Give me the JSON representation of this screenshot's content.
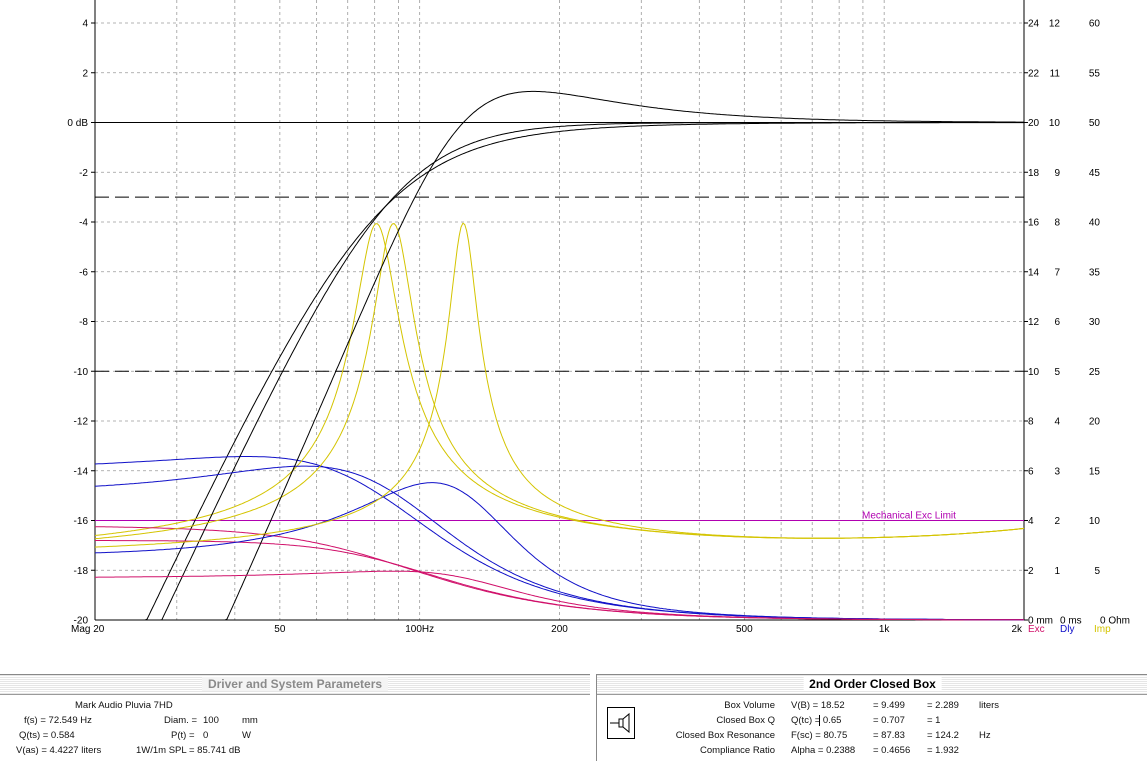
{
  "graph": {
    "left_axis": {
      "ticks": [
        "4",
        "2",
        "0 dB",
        "-2",
        "-4",
        "-6",
        "-8",
        "-10",
        "-12",
        "-14",
        "-16",
        "-18",
        "-20"
      ]
    },
    "right_axis_exc": {
      "ticks": [
        "24",
        "22",
        "20",
        "18",
        "16",
        "14",
        "12",
        "10",
        "8",
        "6",
        "4",
        "2",
        "0 mm"
      ]
    },
    "right_axis_dly": {
      "ticks": [
        "12",
        "11",
        "10",
        "9",
        "8",
        "7",
        "6",
        "5",
        "4",
        "3",
        "2",
        "1",
        "0 ms"
      ]
    },
    "right_axis_imp": {
      "ticks": [
        "60",
        "55",
        "50",
        "45",
        "40",
        "35",
        "30",
        "25",
        "20",
        "15",
        "10",
        "5",
        "0 Ohm"
      ]
    },
    "bottom_axis": {
      "ticks": [
        {
          "freq": 20,
          "label": "Mag 20"
        },
        {
          "freq": 50,
          "label": "50"
        },
        {
          "freq": 100,
          "label": "100Hz"
        },
        {
          "freq": 200,
          "label": "200"
        },
        {
          "freq": 500,
          "label": "500"
        },
        {
          "freq": 1000,
          "label": "1k"
        },
        {
          "freq": 2000,
          "label": "2k"
        }
      ]
    },
    "legend": {
      "exc": "Exc",
      "dly": "Dly",
      "imp": "Imp"
    },
    "mech_limit_label": "Mechanical Exc Limit",
    "colors": {
      "magnitude": "#000000",
      "delay": "#1010c8",
      "impedance": "#d4c400",
      "excursion": "#d0106a",
      "limit": "#b000b0",
      "grid": "#9a9a9a"
    }
  },
  "driver_panel": {
    "title": "Driver and System Parameters",
    "driver_name": "Mark Audio  Pluvia 7HD",
    "fs": "f(s) = 72.549  Hz",
    "qts": "Q(ts) = 0.584",
    "vas": "V(as) = 4.4227  liters",
    "diam_label": "Diam. =",
    "diam_value": "100",
    "diam_unit": "mm",
    "pt_label": "P(t) =",
    "pt_value": "0",
    "pt_unit": "W",
    "spl": "1W/1m SPL = 85.741  dB"
  },
  "box_panel": {
    "title": "2nd Order Closed Box",
    "rows": [
      {
        "label": "Box Volume",
        "sym": "V(B) = 18.52",
        "v2": "= 9.499",
        "v3": "= 2.289",
        "unit": "liters"
      },
      {
        "label": "Closed Box Q",
        "sym": "Q(tc) = 0.65",
        "v2": "= 0.707",
        "v3": "= 1",
        "unit": ""
      },
      {
        "label": "Closed Box Resonance",
        "sym": "F(sc) = 80.75",
        "v2": "= 87.83",
        "v3": "= 124.2",
        "unit": "Hz"
      },
      {
        "label": "Compliance Ratio",
        "sym": "Alpha = 0.2388",
        "v2": "= 0.4656",
        "v3": "= 1.932",
        "unit": ""
      }
    ]
  }
}
